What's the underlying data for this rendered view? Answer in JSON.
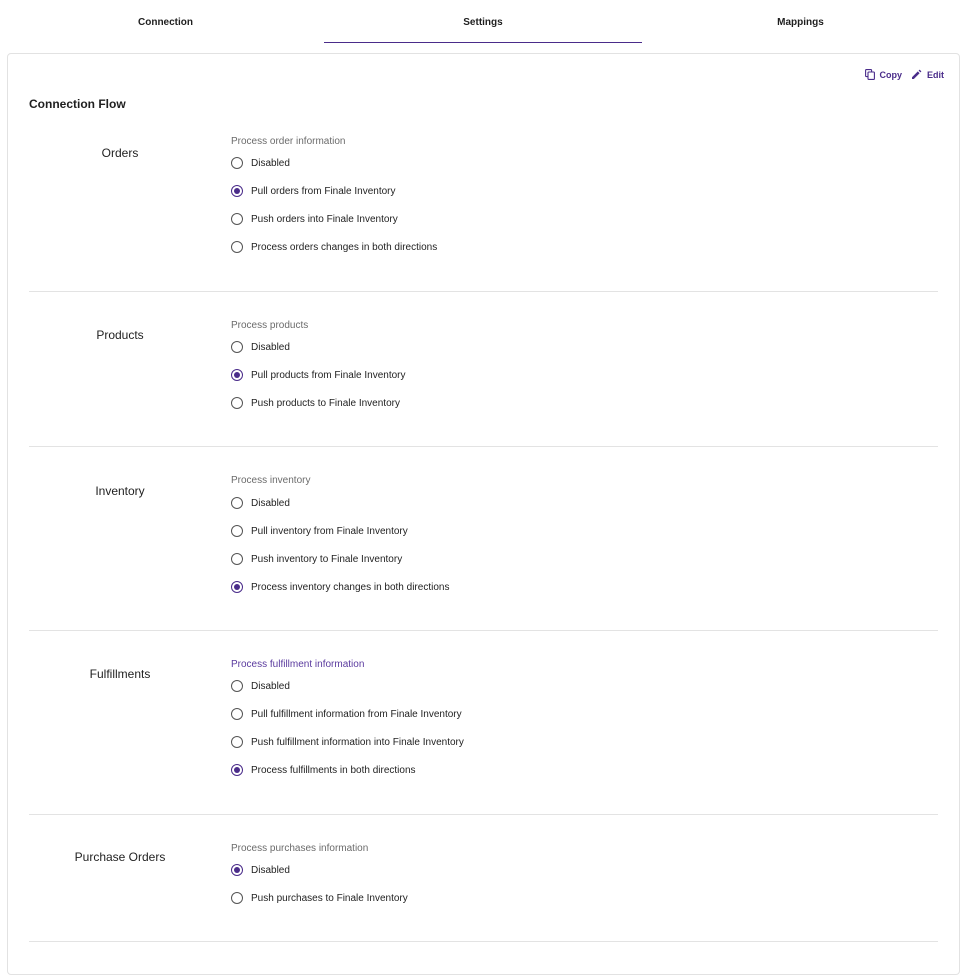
{
  "tabs": [
    {
      "label": "Connection",
      "active": false
    },
    {
      "label": "Settings",
      "active": true
    },
    {
      "label": "Mappings",
      "active": false
    }
  ],
  "actions": {
    "copy_label": "Copy",
    "edit_label": "Edit"
  },
  "colors": {
    "accent": "#4a2c8a",
    "divider": "#e3e3e3"
  },
  "page_title": "Connection Flow",
  "sections": [
    {
      "name": "Orders",
      "group_label": "Process order information",
      "focused": false,
      "options": [
        {
          "label": "Disabled",
          "checked": false
        },
        {
          "label": "Pull orders from Finale Inventory",
          "checked": true
        },
        {
          "label": "Push orders into Finale Inventory",
          "checked": false
        },
        {
          "label": "Process orders changes in both directions",
          "checked": false
        }
      ]
    },
    {
      "name": "Products",
      "group_label": "Process products",
      "focused": false,
      "options": [
        {
          "label": "Disabled",
          "checked": false
        },
        {
          "label": "Pull products from Finale Inventory",
          "checked": true
        },
        {
          "label": "Push products to Finale Inventory",
          "checked": false
        }
      ]
    },
    {
      "name": "Inventory",
      "group_label": "Process inventory",
      "focused": false,
      "options": [
        {
          "label": "Disabled",
          "checked": false
        },
        {
          "label": "Pull inventory from Finale Inventory",
          "checked": false
        },
        {
          "label": "Push inventory to Finale Inventory",
          "checked": false
        },
        {
          "label": "Process inventory changes in both directions",
          "checked": true
        }
      ]
    },
    {
      "name": "Fulfillments",
      "group_label": "Process fulfillment information",
      "focused": true,
      "options": [
        {
          "label": "Disabled",
          "checked": false
        },
        {
          "label": "Pull fulfillment information from Finale Inventory",
          "checked": false
        },
        {
          "label": "Push fulfillment information into Finale Inventory",
          "checked": false
        },
        {
          "label": "Process fulfillments in both directions",
          "checked": true
        }
      ]
    },
    {
      "name": "Purchase Orders",
      "group_label": "Process purchases information",
      "focused": false,
      "options": [
        {
          "label": "Disabled",
          "checked": true
        },
        {
          "label": "Push purchases to Finale Inventory",
          "checked": false
        }
      ]
    }
  ]
}
